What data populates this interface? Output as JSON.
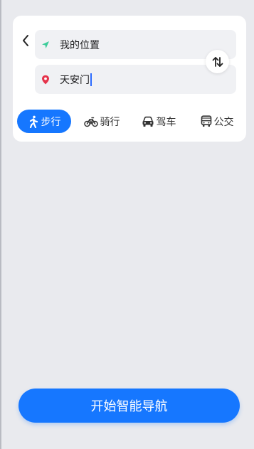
{
  "route": {
    "from": {
      "value": "我的位置"
    },
    "to": {
      "value": "天安门"
    }
  },
  "modes": [
    {
      "label": "步行",
      "icon": "walk-icon",
      "active": true
    },
    {
      "label": "骑行",
      "icon": "bike-icon",
      "active": false
    },
    {
      "label": "驾车",
      "icon": "car-icon",
      "active": false
    },
    {
      "label": "公交",
      "icon": "bus-icon",
      "active": false
    }
  ],
  "action": {
    "label": "开始智能导航"
  },
  "colors": {
    "accent": "#1677ff",
    "location_arrow": "#3ccc9a",
    "destination_pin": "#e5334b"
  }
}
